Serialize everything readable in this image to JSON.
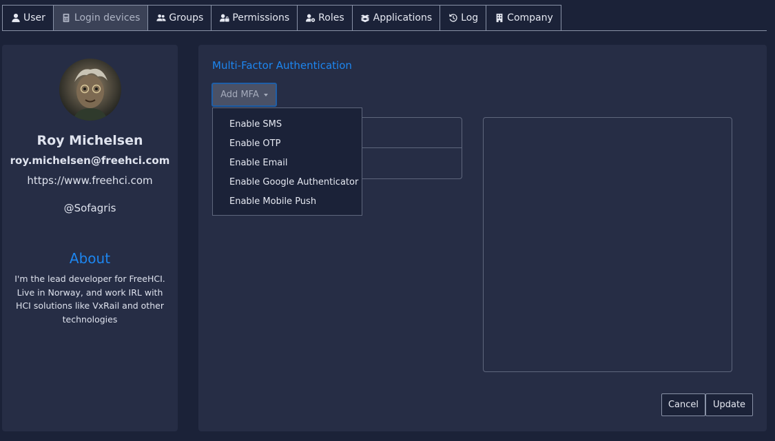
{
  "tabs": [
    {
      "label": "User",
      "icon": "user-icon",
      "active": false
    },
    {
      "label": "Login devices",
      "icon": "device-icon",
      "active": true
    },
    {
      "label": "Groups",
      "icon": "users-icon",
      "active": false
    },
    {
      "label": "Permissions",
      "icon": "user-lock-icon",
      "active": false
    },
    {
      "label": "Roles",
      "icon": "user-gear-icon",
      "active": false
    },
    {
      "label": "Applications",
      "icon": "boxes-icon",
      "active": false
    },
    {
      "label": "Log",
      "icon": "history-icon",
      "active": false
    },
    {
      "label": "Company",
      "icon": "building-icon",
      "active": false
    }
  ],
  "profile": {
    "name": "Roy Michelsen",
    "email": "roy.michelsen@freehci.com",
    "url": "https://www.freehci.com",
    "handle": "@Sofagris",
    "about_title": "About",
    "about_text": "I'm the lead developer for FreeHCI. Live in Norway, and work IRL with HCI solutions like VxRail and other technologies"
  },
  "mfa": {
    "title": "Multi-Factor Authentication",
    "add_button": "Add MFA",
    "dropdown": [
      "Enable SMS",
      "Enable OTP",
      "Enable Email",
      "Enable Google Authenticator",
      "Enable Mobile Push"
    ]
  },
  "actions": {
    "cancel": "Cancel",
    "update": "Update"
  },
  "colors": {
    "background": "#1b2238",
    "card": "#262d45",
    "accent": "#1d86f0",
    "active_tab": "#3b4257"
  }
}
